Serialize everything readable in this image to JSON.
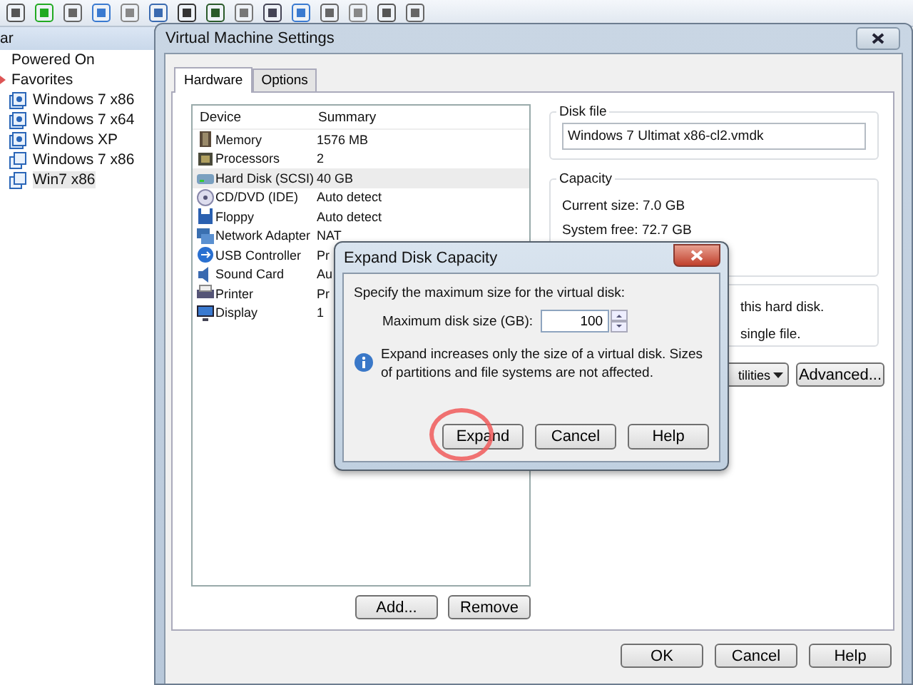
{
  "sidebar": {
    "header": "ar",
    "items": [
      {
        "label": "Powered On",
        "kind": "group",
        "selected": false
      },
      {
        "label": "Favorites",
        "kind": "favorites",
        "selected": false
      },
      {
        "label": "Windows 7 x86",
        "kind": "vm",
        "selected": false
      },
      {
        "label": "Windows 7 x64",
        "kind": "vm",
        "selected": false
      },
      {
        "label": "Windows XP",
        "kind": "vm",
        "selected": false
      },
      {
        "label": "Windows 7 x86",
        "kind": "vm-clone",
        "selected": false
      },
      {
        "label": "Win7 x86",
        "kind": "vm-clone",
        "selected": true
      }
    ]
  },
  "window": {
    "title": "Virtual Machine Settings",
    "tabs": [
      {
        "label": "Hardware",
        "selected": true
      },
      {
        "label": "Options",
        "selected": false
      }
    ],
    "devices": {
      "columns": [
        "Device",
        "Summary"
      ],
      "rows": [
        {
          "device": "Memory",
          "summary": "1576 MB",
          "kind": "memory",
          "selected": false
        },
        {
          "device": "Processors",
          "summary": "2",
          "kind": "cpu",
          "selected": false
        },
        {
          "device": "Hard Disk (SCSI)",
          "summary": "40 GB",
          "kind": "disk",
          "selected": true
        },
        {
          "device": "CD/DVD (IDE)",
          "summary": "Auto detect",
          "kind": "cd",
          "selected": false
        },
        {
          "device": "Floppy",
          "summary": "Auto detect",
          "kind": "floppy",
          "selected": false
        },
        {
          "device": "Network Adapter",
          "summary": "NAT",
          "kind": "network",
          "selected": false
        },
        {
          "device": "USB Controller",
          "summary": "Pr",
          "kind": "usb",
          "selected": false
        },
        {
          "device": "Sound Card",
          "summary": "Au",
          "kind": "sound",
          "selected": false
        },
        {
          "device": "Printer",
          "summary": "Pr",
          "kind": "printer",
          "selected": false
        },
        {
          "device": "Display",
          "summary": "1",
          "kind": "display",
          "selected": false
        }
      ]
    },
    "device_buttons": [
      "Add...",
      "Remove"
    ],
    "disk_file": {
      "label": "Disk file",
      "value": "Windows 7 Ultimat x86-cl2.vmdk"
    },
    "capacity": {
      "label": "Capacity",
      "lines": [
        "Current size: 7.0 GB",
        "System free: 72.7 GB"
      ]
    },
    "disk_info": {
      "lines": [
        "this hard disk.",
        "single file."
      ]
    },
    "disk_buttons": [
      {
        "label": "tilities",
        "kind": "menu"
      },
      {
        "label": "Advanced...",
        "kind": "plain"
      }
    ],
    "buttons": [
      "OK",
      "Cancel",
      "Help"
    ]
  },
  "dialog": {
    "title": "Expand Disk Capacity",
    "prompt": "Specify the maximum size for the virtual disk:",
    "size_label": "Maximum disk size (GB):",
    "size_value": "100",
    "info": "Expand increases only the size of a virtual disk. Sizes of partitions and file systems are not affected.",
    "buttons": [
      {
        "label": "Expand",
        "highlighted": true
      },
      {
        "label": "Cancel",
        "highlighted": false
      },
      {
        "label": "Help",
        "highlighted": false
      }
    ]
  }
}
